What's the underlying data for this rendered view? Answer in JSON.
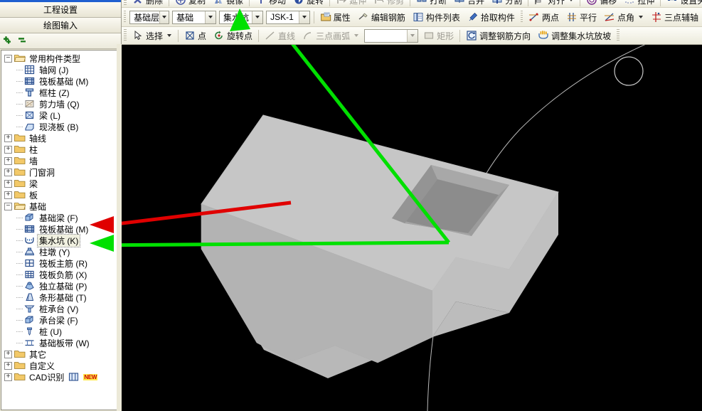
{
  "left_panel": {
    "nav_buttons": [
      {
        "label": "工程设置",
        "name": "project-settings-button"
      },
      {
        "label": "绘图输入",
        "name": "drawing-input-button"
      }
    ],
    "panel_tools": [
      {
        "label": "添加",
        "icon": "plus-icon"
      },
      {
        "label": "删除",
        "icon": "minus-icon"
      }
    ],
    "tree": [
      {
        "label": "常用构件类型",
        "type": "folder",
        "expanded": true,
        "level": 1
      },
      {
        "label": "轴网 (J)",
        "type": "item",
        "level": 2,
        "icon": "grid-icon"
      },
      {
        "label": "筏板基础 (M)",
        "type": "item",
        "level": 2,
        "icon": "raft-icon"
      },
      {
        "label": "框柱 (Z)",
        "type": "item",
        "level": 2,
        "icon": "column-icon"
      },
      {
        "label": "剪力墙 (Q)",
        "type": "item",
        "level": 2,
        "icon": "shearwall-icon"
      },
      {
        "label": "梁 (L)",
        "type": "item",
        "level": 2,
        "icon": "beam-icon"
      },
      {
        "label": "现浇板 (B)",
        "type": "item",
        "level": 2,
        "icon": "slab-icon"
      },
      {
        "label": "轴线",
        "type": "folder",
        "expanded": false,
        "level": 1
      },
      {
        "label": "柱",
        "type": "folder",
        "expanded": false,
        "level": 1
      },
      {
        "label": "墙",
        "type": "folder",
        "expanded": false,
        "level": 1
      },
      {
        "label": "门窗洞",
        "type": "folder",
        "expanded": false,
        "level": 1
      },
      {
        "label": "梁",
        "type": "folder",
        "expanded": false,
        "level": 1
      },
      {
        "label": "板",
        "type": "folder",
        "expanded": false,
        "level": 1
      },
      {
        "label": "基础",
        "type": "folder",
        "expanded": true,
        "level": 1
      },
      {
        "label": "基础梁 (F)",
        "type": "item",
        "level": 2,
        "icon": "foundation-beam-icon"
      },
      {
        "label": "筏板基础 (M)",
        "type": "item",
        "level": 2,
        "icon": "raft-icon"
      },
      {
        "label": "集水坑 (K)",
        "type": "item",
        "level": 2,
        "icon": "sump-pit-icon",
        "selected": true
      },
      {
        "label": "柱墩 (Y)",
        "type": "item",
        "level": 2,
        "icon": "pier-icon"
      },
      {
        "label": "筏板主筋 (R)",
        "type": "item",
        "level": 2,
        "icon": "main-rebar-icon"
      },
      {
        "label": "筏板负筋 (X)",
        "type": "item",
        "level": 2,
        "icon": "neg-rebar-icon"
      },
      {
        "label": "独立基础 (P)",
        "type": "item",
        "level": 2,
        "icon": "isolated-footing-icon"
      },
      {
        "label": "条形基础 (T)",
        "type": "item",
        "level": 2,
        "icon": "strip-footing-icon"
      },
      {
        "label": "桩承台 (V)",
        "type": "item",
        "level": 2,
        "icon": "pile-cap-icon"
      },
      {
        "label": "承台梁 (F)",
        "type": "item",
        "level": 2,
        "icon": "cap-beam-icon"
      },
      {
        "label": "桩 (U)",
        "type": "item",
        "level": 2,
        "icon": "pile-icon"
      },
      {
        "label": "基础板带 (W)",
        "type": "item",
        "level": 2,
        "icon": "slab-band-icon"
      },
      {
        "label": "其它",
        "type": "folder",
        "expanded": false,
        "level": 1
      },
      {
        "label": "自定义",
        "type": "folder",
        "expanded": false,
        "level": 1
      },
      {
        "label": "CAD识别",
        "type": "folder",
        "expanded": false,
        "level": 1,
        "badge": "NEW"
      }
    ]
  },
  "toolbar_row0": [
    {
      "label": "删除",
      "icon": "delete-icon"
    },
    {
      "label": "复制",
      "icon": "copy-icon"
    },
    {
      "label": "镜像",
      "icon": "mirror-icon"
    },
    {
      "label": "移动",
      "icon": "move-icon"
    },
    {
      "label": "旋转",
      "icon": "rotate-icon"
    },
    {
      "label": "延伸",
      "icon": "extend-icon",
      "disabled": true
    },
    {
      "label": "修剪",
      "icon": "trim-icon",
      "disabled": true
    },
    {
      "label": "打断",
      "icon": "break-icon"
    },
    {
      "label": "合并",
      "icon": "merge-icon"
    },
    {
      "label": "分割",
      "icon": "split-icon"
    },
    {
      "label": "对齐",
      "icon": "align-icon",
      "dropdown": true
    },
    {
      "label": "偏移",
      "icon": "offset-icon"
    },
    {
      "label": "拉伸",
      "icon": "stretch-icon"
    },
    {
      "label": "设置夹点",
      "icon": "grip-point-icon"
    }
  ],
  "toolbar_row1": {
    "combos": [
      {
        "name": "floor-selector",
        "value": "基础层"
      },
      {
        "name": "category-selector",
        "value": "基础"
      },
      {
        "name": "component-type-selector",
        "value": "集水坑"
      },
      {
        "name": "component-name-selector",
        "value": "JSK-1"
      }
    ],
    "buttons": [
      {
        "label": "属性",
        "icon": "properties-icon"
      },
      {
        "label": "编辑钢筋",
        "icon": "edit-rebar-icon"
      },
      {
        "label": "构件列表",
        "icon": "component-list-icon"
      },
      {
        "label": "拾取构件",
        "icon": "pick-component-icon"
      }
    ],
    "axis_buttons": [
      {
        "label": "两点",
        "icon": "two-point-icon"
      },
      {
        "label": "平行",
        "icon": "parallel-icon"
      },
      {
        "label": "点角",
        "icon": "point-angle-icon",
        "dropdown": true
      },
      {
        "label": "三点辅轴",
        "icon": "three-point-axis-icon"
      }
    ]
  },
  "toolbar_row2": {
    "items": [
      {
        "label": "选择",
        "icon": "select-arrow-icon",
        "dropdown": true
      },
      {
        "label": "点",
        "icon": "point-icon"
      },
      {
        "label": "旋转点",
        "icon": "rotate-point-icon"
      },
      {
        "label": "直线",
        "icon": "line-icon",
        "disabled": true
      },
      {
        "label": "三点画弧",
        "icon": "three-point-arc-icon",
        "disabled": true,
        "dropdown": true
      },
      {
        "label": "矩形",
        "icon": "rectangle-icon",
        "disabled": true
      },
      {
        "label": "调整钢筋方向",
        "icon": "adjust-rebar-direction-icon"
      },
      {
        "label": "调整集水坑放坡",
        "icon": "adjust-sump-slope-icon"
      }
    ],
    "empty_combo": {
      "name": "arc-style-selector",
      "value": ""
    }
  },
  "viewport": {
    "name": "3d-model-viewport",
    "background_color": "#000000",
    "model": {
      "name": "raft-foundation-with-sump-pit",
      "top_face_color": "#c9c9c9",
      "front_face_color": "#b0b0b0",
      "side_face_color": "#bdbdbd",
      "pit_color": "#9b9b9b",
      "pit_inner_color": "#868686"
    },
    "annotations": [
      {
        "name": "green-arrow-to-tree-item",
        "color": "#00e000",
        "type": "arrow"
      },
      {
        "name": "green-arrow-to-toolbar",
        "color": "#00e000",
        "type": "arrow"
      },
      {
        "name": "red-arrow-to-raft-item",
        "color": "#e00000",
        "type": "arrow"
      }
    ],
    "grid": {
      "name": "axis-grid-line",
      "color": "#b9b9b9",
      "bubble_label": ""
    }
  }
}
